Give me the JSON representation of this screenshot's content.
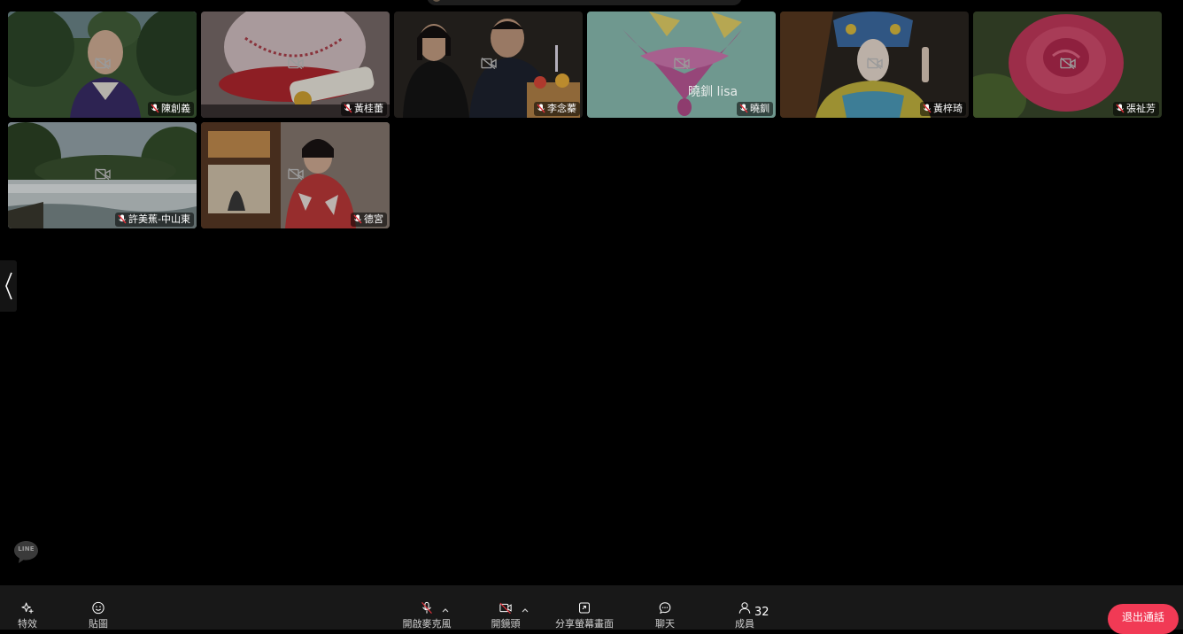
{
  "participants": [
    {
      "name": "陳創義"
    },
    {
      "name": "黃桂蕾"
    },
    {
      "name": "李念蓁"
    },
    {
      "name": "曉釧"
    },
    {
      "name": "黃梓琦"
    },
    {
      "name": "張祉芳"
    },
    {
      "name": "許美蕉-中山東"
    },
    {
      "name": "德宮"
    }
  ],
  "tile_overlay_text": {
    "xiaochuan_lisa": "曉釧 lisa"
  },
  "logo": {
    "text": "LINE"
  },
  "toolbar": {
    "effects_label": "特效",
    "stickers_label": "貼圖",
    "mic_label": "開啟麥克風",
    "camera_label": "開鏡頭",
    "share_label": "分享螢幕畫面",
    "chat_label": "聊天",
    "members_label": "成員",
    "members_count": "32",
    "leave_label": "退出通話"
  },
  "colors": {
    "background": "#000000",
    "toolbar": "#181818",
    "leave_button": "#f13a55",
    "muted_red": "#e0323c"
  }
}
